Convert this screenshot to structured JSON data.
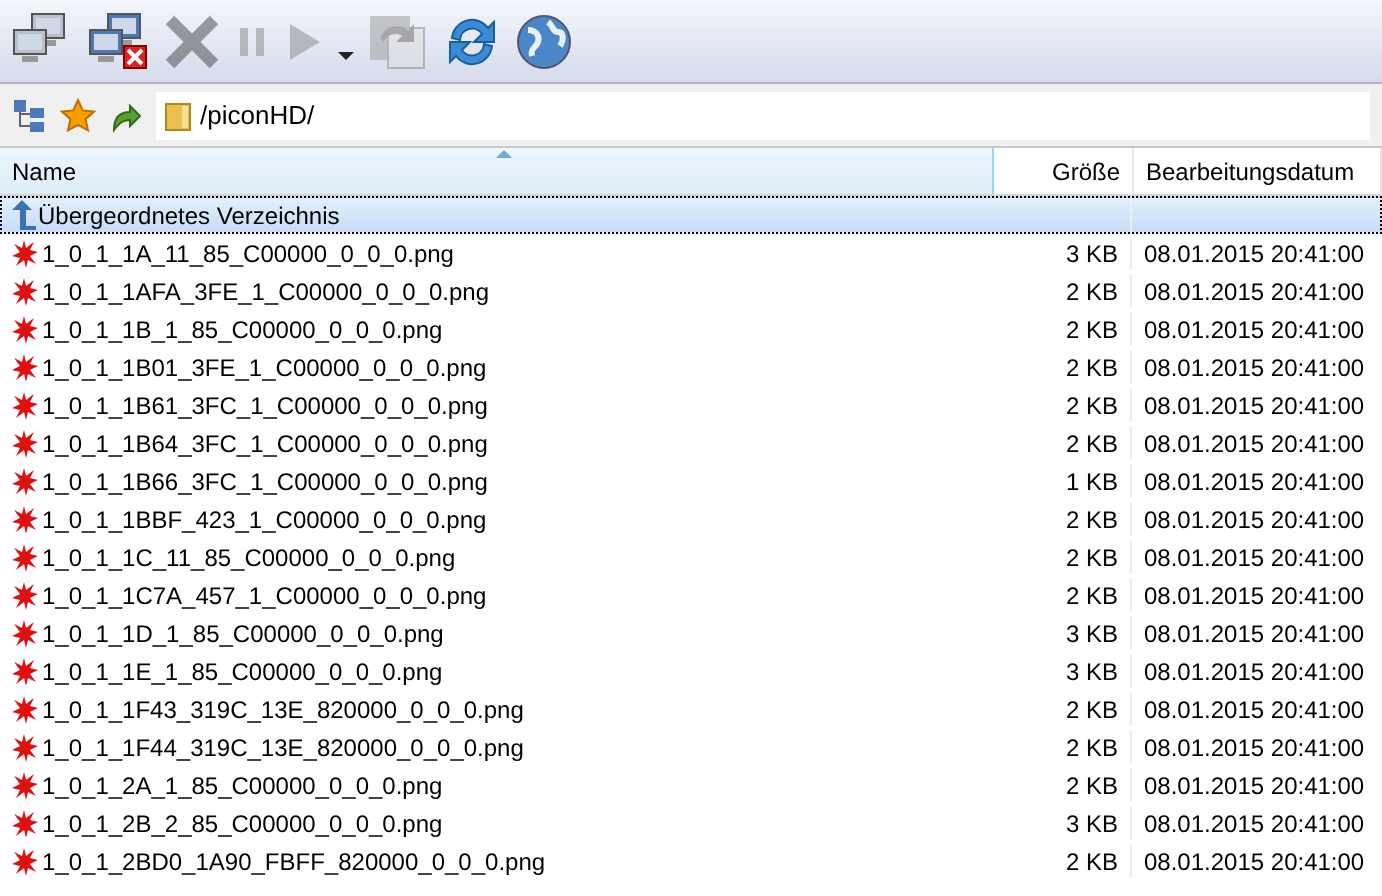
{
  "toolbar": {
    "buttons": [
      {
        "kind": "computers",
        "disabled": false
      },
      {
        "kind": "disconnect",
        "disabled": false
      },
      {
        "kind": "cancel",
        "disabled": true
      },
      {
        "kind": "pause",
        "disabled": true
      },
      {
        "kind": "play",
        "disabled": true
      },
      {
        "kind": "caret",
        "disabled": false
      },
      {
        "kind": "copy",
        "disabled": true
      },
      {
        "kind": "refresh",
        "disabled": false
      },
      {
        "kind": "globe",
        "disabled": false
      }
    ]
  },
  "address": {
    "value": "/piconHD/"
  },
  "table": {
    "columns": [
      {
        "label": "Name",
        "sorted": true
      },
      {
        "label": "Größe",
        "sorted": false
      },
      {
        "label": "Bearbeitungsdatum",
        "sorted": false
      }
    ],
    "rows": [
      {
        "kind": "parent",
        "name": "Übergeordnetes Verzeichnis",
        "selected": true
      },
      {
        "kind": "file",
        "name": "1_0_1_1A_11_85_C00000_0_0_0.png",
        "size": "3 KB",
        "date": "08.01.2015 20:41:00",
        "selected": false
      },
      {
        "kind": "file",
        "name": "1_0_1_1AFA_3FE_1_C00000_0_0_0.png",
        "size": "2 KB",
        "date": "08.01.2015 20:41:00",
        "selected": false
      },
      {
        "kind": "file",
        "name": "1_0_1_1B_1_85_C00000_0_0_0.png",
        "size": "2 KB",
        "date": "08.01.2015 20:41:00",
        "selected": false
      },
      {
        "kind": "file",
        "name": "1_0_1_1B01_3FE_1_C00000_0_0_0.png",
        "size": "2 KB",
        "date": "08.01.2015 20:41:00",
        "selected": false
      },
      {
        "kind": "file",
        "name": "1_0_1_1B61_3FC_1_C00000_0_0_0.png",
        "size": "2 KB",
        "date": "08.01.2015 20:41:00",
        "selected": false
      },
      {
        "kind": "file",
        "name": "1_0_1_1B64_3FC_1_C00000_0_0_0.png",
        "size": "2 KB",
        "date": "08.01.2015 20:41:00",
        "selected": false
      },
      {
        "kind": "file",
        "name": "1_0_1_1B66_3FC_1_C00000_0_0_0.png",
        "size": "1 KB",
        "date": "08.01.2015 20:41:00",
        "selected": false
      },
      {
        "kind": "file",
        "name": "1_0_1_1BBF_423_1_C00000_0_0_0.png",
        "size": "2 KB",
        "date": "08.01.2015 20:41:00",
        "selected": false
      },
      {
        "kind": "file",
        "name": "1_0_1_1C_11_85_C00000_0_0_0.png",
        "size": "2 KB",
        "date": "08.01.2015 20:41:00",
        "selected": false
      },
      {
        "kind": "file",
        "name": "1_0_1_1C7A_457_1_C00000_0_0_0.png",
        "size": "2 KB",
        "date": "08.01.2015 20:41:00",
        "selected": false
      },
      {
        "kind": "file",
        "name": "1_0_1_1D_1_85_C00000_0_0_0.png",
        "size": "3 KB",
        "date": "08.01.2015 20:41:00",
        "selected": false
      },
      {
        "kind": "file",
        "name": "1_0_1_1E_1_85_C00000_0_0_0.png",
        "size": "3 KB",
        "date": "08.01.2015 20:41:00",
        "selected": false
      },
      {
        "kind": "file",
        "name": "1_0_1_1F43_319C_13E_820000_0_0_0.png",
        "size": "2 KB",
        "date": "08.01.2015 20:41:00",
        "selected": false
      },
      {
        "kind": "file",
        "name": "1_0_1_1F44_319C_13E_820000_0_0_0.png",
        "size": "2 KB",
        "date": "08.01.2015 20:41:00",
        "selected": false
      },
      {
        "kind": "file",
        "name": "1_0_1_2A_1_85_C00000_0_0_0.png",
        "size": "2 KB",
        "date": "08.01.2015 20:41:00",
        "selected": false
      },
      {
        "kind": "file",
        "name": "1_0_1_2B_2_85_C00000_0_0_0.png",
        "size": "3 KB",
        "date": "08.01.2015 20:41:00",
        "selected": false
      },
      {
        "kind": "file",
        "name": "1_0_1_2BD0_1A90_FBFF_820000_0_0_0.png",
        "size": "2 KB",
        "date": "08.01.2015 20:41:00",
        "selected": false
      }
    ]
  }
}
